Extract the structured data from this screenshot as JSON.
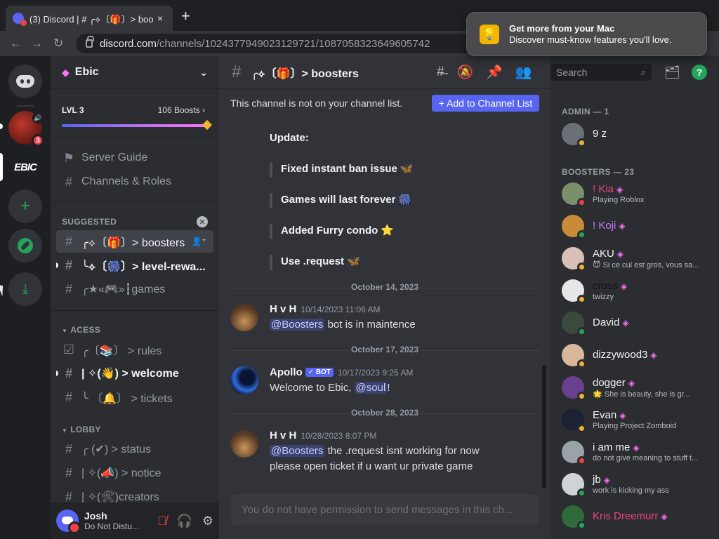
{
  "browser": {
    "tab_title": "(3) Discord | # ╭⟡〔🎁〕> boo",
    "tab_close": "×",
    "new_tab": "+",
    "back": "←",
    "forward": "→",
    "reload": "↻",
    "url_host": "discord.com",
    "url_path": "/channels/1024377949023129721/1087058323649605742"
  },
  "notification": {
    "title": "Get more from your Mac",
    "body": "Discover must-know features you'll love.",
    "icon": "lightbulb-icon"
  },
  "rail": {
    "server2_label": "EBIC",
    "server1_badge": "3"
  },
  "server": {
    "name": "Ebic",
    "level": "LVL 3",
    "boosts": "106 Boosts",
    "boosts_chevron": "›",
    "nav": [
      {
        "icon": "⚑",
        "label": "Server Guide"
      },
      {
        "icon": "#",
        "label": "Channels & Roles"
      }
    ],
    "categories": {
      "suggested": "SUGGESTED",
      "acess": "ACESS",
      "lobby": "LOBBY"
    },
    "suggested_channels": [
      {
        "label": "╭⟡〔🎁〕> boosters"
      },
      {
        "label": "╰⟡〔🎆〕> level-rewa..."
      },
      {
        "label": "╭★«🎮»┇games"
      }
    ],
    "acess_channels": [
      {
        "label": "╭〔📚〕 > rules"
      },
      {
        "label": "| ✧(👋) > welcome"
      },
      {
        "label": "╰ 〔🔔〕 > tickets"
      }
    ],
    "lobby_channels": [
      {
        "label": "╭ (✔) > status"
      },
      {
        "label": "| ✧(📣) > notice"
      },
      {
        "label": "| ✧(🛠)creators"
      }
    ]
  },
  "user": {
    "name": "Josh",
    "status": "Do Not Distu..."
  },
  "channel": {
    "name": "╭⟡〔🎁〕> boosters",
    "not_on_list": "This channel is not on your channel list.",
    "add_button": "+ Add to Channel List",
    "search_placeholder": "Search"
  },
  "messages": {
    "update_heading": "Update:",
    "updates": [
      {
        "text": "Fixed instant ban issue",
        "emoji": "🦋"
      },
      {
        "text": "Games will last forever",
        "emoji": "🎆"
      },
      {
        "text": "Added Furry condo",
        "emoji": "⭐"
      },
      {
        "text": "Use .request",
        "emoji": "🦋"
      }
    ],
    "dates": [
      "October 14, 2023",
      "October 17, 2023",
      "October 28, 2023"
    ],
    "list": [
      {
        "author": "H v H",
        "time": "10/14/2023 11:06 AM",
        "mention": "@Boosters",
        "text": " bot is in maintence"
      },
      {
        "author": "Apollo",
        "bot": "✓ BOT",
        "time": "10/17/2023 9:25 AM",
        "pre": "Welcome to Ebic, ",
        "mention": "@soul",
        "post": "!"
      },
      {
        "author": "H v H",
        "time": "10/28/2023 8:07 PM",
        "mention": "@Boosters",
        "text": " the .request isnt working for now",
        "text2": "please open ticket if u want ur private game"
      }
    ],
    "input_placeholder": "You do not have permission to send messages in this ch..."
  },
  "members": {
    "admin_header": "ADMIN — 1",
    "boosters_header": "BOOSTERS — 23",
    "admin": [
      {
        "name": "9 z",
        "status": "idle",
        "color": "#f2f3f5",
        "avatar": "#6b6f76"
      }
    ],
    "boosters": [
      {
        "name": "! Kia",
        "activity": "Playing Roblox",
        "status": "dnd",
        "color": "#f23f8a",
        "avatar": "#7b8f6a"
      },
      {
        "name": "! Koji",
        "activity": "",
        "status": "on",
        "color": "#c77dff",
        "avatar": "#c98a3a"
      },
      {
        "name": "AKU",
        "activity": "😈 Si ce cul est gros, vous sa...",
        "status": "idle",
        "color": "#f2f3f5",
        "avatar": "#d8c0b8"
      },
      {
        "name": "cross",
        "activity": "twizzy",
        "status": "idle",
        "color": "#111214",
        "avatar": "#e6e6e6"
      },
      {
        "name": "David",
        "activity": "",
        "status": "on",
        "color": "#f2f3f5",
        "avatar": "#3c4a3e"
      },
      {
        "name": "dizzywood3",
        "activity": "",
        "status": "idle",
        "color": "#f2f3f5",
        "avatar": "#d8b89a"
      },
      {
        "name": "dogger",
        "activity": "🌟 She is beauty, she is gr...",
        "status": "idle",
        "color": "#f2f3f5",
        "avatar": "#6a3f8f"
      },
      {
        "name": "Evan",
        "activity": "Playing Project Zomboid",
        "status": "idle",
        "color": "#f2f3f5",
        "avatar": "#1c2233"
      },
      {
        "name": "i am me",
        "activity": "do not give meaning to stuff t...",
        "status": "dnd",
        "color": "#f2f3f5",
        "avatar": "#9aa3a8"
      },
      {
        "name": "jb",
        "activity": "work is kicking my ass",
        "status": "on",
        "color": "#f2f3f5",
        "avatar": "#cfd3d6"
      },
      {
        "name": "Kris Dreemurr",
        "activity": "",
        "status": "on",
        "color": "#f23f8a",
        "avatar": "#2f6b3a"
      }
    ]
  }
}
